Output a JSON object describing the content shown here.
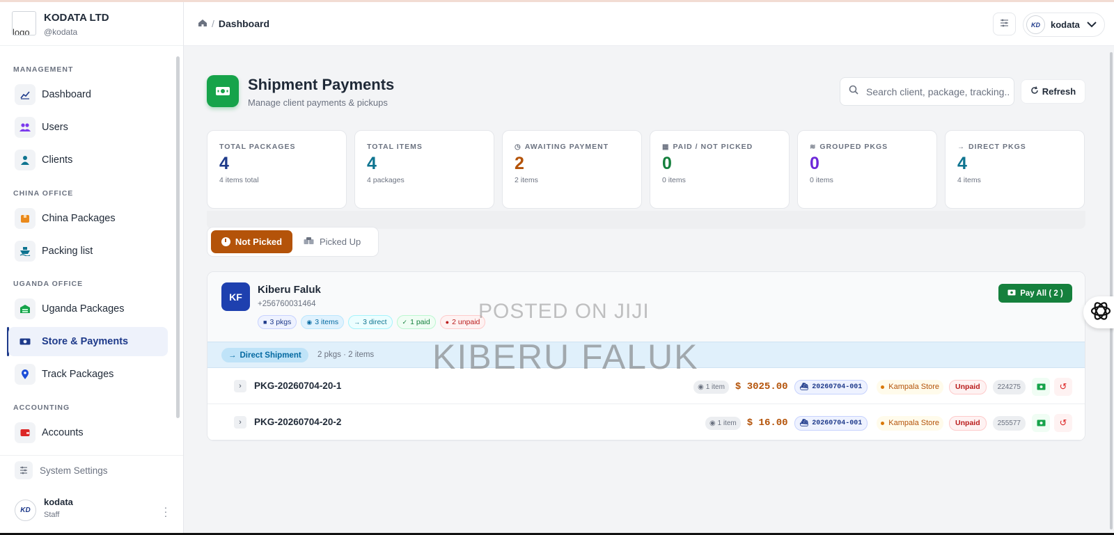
{
  "brand": {
    "name": "KODATA LTD",
    "handle": "@kodata",
    "logo_alt": "logo"
  },
  "sidebar": {
    "sections": [
      {
        "title": "MANAGEMENT"
      },
      {
        "title": "CHINA OFFICE"
      },
      {
        "title": "UGANDA OFFICE"
      },
      {
        "title": "ACCOUNTING"
      }
    ],
    "items": [
      {
        "label": "Dashboard",
        "icon": "chart-icon"
      },
      {
        "label": "Users",
        "icon": "users-icon"
      },
      {
        "label": "Clients",
        "icon": "user-icon"
      },
      {
        "label": "China Packages",
        "icon": "box-icon"
      },
      {
        "label": "Packing list",
        "icon": "ship-icon"
      },
      {
        "label": "Uganda Packages",
        "icon": "warehouse-icon"
      },
      {
        "label": "Store & Payments",
        "icon": "money-icon",
        "active": true
      },
      {
        "label": "Track Packages",
        "icon": "location-pin-icon"
      },
      {
        "label": "Accounts",
        "icon": "wallet-icon"
      }
    ],
    "footer": {
      "settings_label": "System Settings",
      "user": {
        "name": "kodata",
        "role": "Staff",
        "avatar_text": "KD"
      }
    }
  },
  "topbar": {
    "breadcrumb": {
      "sep": "/",
      "current": "Dashboard"
    },
    "user": {
      "name": "kodata",
      "avatar_text": "KD"
    }
  },
  "page": {
    "title": "Shipment Payments",
    "subtitle": "Manage client payments & pickups",
    "search_placeholder": "Search client, package, tracking...",
    "refresh_label": "Refresh"
  },
  "stats": [
    {
      "title": "TOTAL PACKAGES",
      "value": "4",
      "sub": "4 items total",
      "color": "#1e3a8a"
    },
    {
      "title": "TOTAL ITEMS",
      "value": "4",
      "sub": "4 packages",
      "color": "#0e7490"
    },
    {
      "title": "AWAITING PAYMENT",
      "value": "2",
      "sub": "2 items",
      "color": "#b45309",
      "icon": "clock-icon"
    },
    {
      "title": "PAID / NOT PICKED",
      "value": "0",
      "sub": "0 items",
      "color": "#15803d",
      "icon": "boxes-icon"
    },
    {
      "title": "GROUPED PKGS",
      "value": "0",
      "sub": "0 items",
      "color": "#6d28d9",
      "icon": "layers-icon"
    },
    {
      "title": "DIRECT PKGS",
      "value": "4",
      "sub": "4 items",
      "color": "#0e7490",
      "icon": "arrow-right-icon"
    }
  ],
  "tabs": {
    "not_picked": "Not Picked",
    "picked_up": "Picked Up"
  },
  "client": {
    "initials": "KF",
    "name": "Kiberu Faluk",
    "phone": "+256760031464",
    "chips": [
      "3 pkgs",
      "3 items",
      "3 direct",
      "1 paid",
      "2 unpaid"
    ],
    "pay_all": "Pay All ( 2 )",
    "shipment": {
      "label": "Direct Shipment",
      "meta": "2 pkgs · 2 items"
    },
    "packages": [
      {
        "id": "PKG-20260704-20-1",
        "count": "1 item",
        "amount": "$ 3025.00",
        "tracking": "20260704-001",
        "store": "Kampala Store",
        "status": "Unpaid",
        "code": "224275"
      },
      {
        "id": "PKG-20260704-20-2",
        "count": "1 item",
        "amount": "$ 16.00",
        "tracking": "20260704-001",
        "store": "Kampala Store",
        "status": "Unpaid",
        "code": "255577"
      }
    ]
  },
  "watermark": {
    "line1": "POSTED ON JIJI",
    "line2": "KIBERU FALUK"
  },
  "colors": {
    "accent": "#1e3a8a",
    "green": "#16a34a",
    "amber": "#b45309"
  }
}
